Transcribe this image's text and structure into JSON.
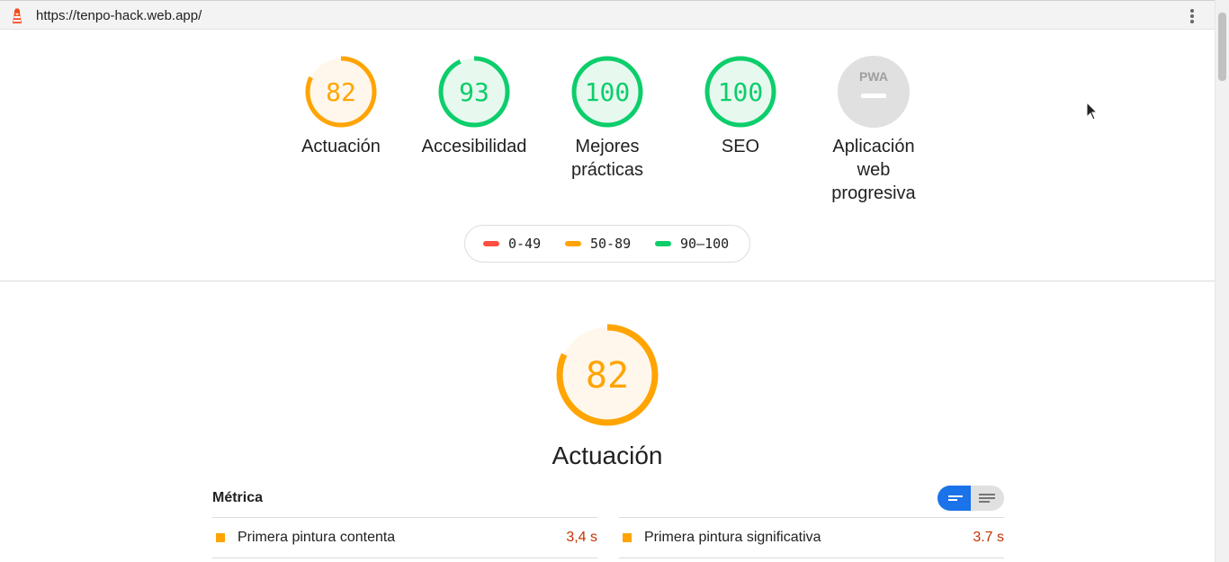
{
  "browser": {
    "url": "https://tenpo-hack.web.app/"
  },
  "colors": {
    "fail": "#ff4e42",
    "average": "#ffa400",
    "pass": "#0cce6b",
    "neutral": "#e0e0e0"
  },
  "categories": [
    {
      "score": "82",
      "label": "Actuación",
      "value": 82,
      "rating": "average"
    },
    {
      "score": "93",
      "label": "Accesibilidad",
      "value": 93,
      "rating": "pass"
    },
    {
      "score": "100",
      "label": "Mejores prácticas",
      "value": 100,
      "rating": "pass"
    },
    {
      "score": "100",
      "label": "SEO",
      "value": 100,
      "rating": "pass"
    },
    {
      "score": "",
      "label": "Aplicación web progresiva",
      "badge": "PWA",
      "rating": "neutral"
    }
  ],
  "legend": [
    {
      "label": "0-49",
      "rating": "fail"
    },
    {
      "label": "50-89",
      "rating": "average"
    },
    {
      "label": "90–100",
      "rating": "pass"
    }
  ],
  "performance": {
    "score": "82",
    "value": 82,
    "title": "Actuación",
    "metrics_title": "Métrica",
    "metrics": [
      {
        "name": "Primera pintura contenta",
        "value": "3,4 s"
      },
      {
        "name": "Primera pintura significativa",
        "value": "3.7 s"
      }
    ]
  }
}
